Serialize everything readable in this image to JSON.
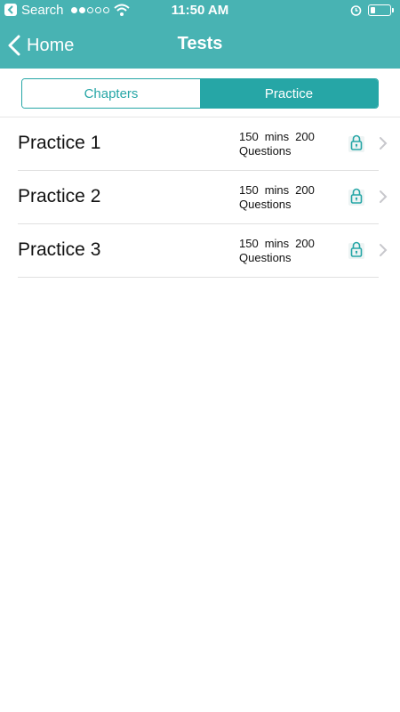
{
  "status_bar": {
    "back_app": "Search",
    "time": "11:50 AM",
    "signal_bars_on": 2,
    "signal_bars_total": 5,
    "battery_level": 0.25
  },
  "nav": {
    "back_label": "Home",
    "title": "Tests"
  },
  "tabs": [
    {
      "label": "Chapters",
      "selected": false
    },
    {
      "label": "Practice",
      "selected": true
    }
  ],
  "practices": [
    {
      "title": "Practice 1",
      "duration": "150",
      "duration_unit": "mins",
      "questions": "200",
      "questions_label": "Questions",
      "locked": true
    },
    {
      "title": "Practice 2",
      "duration": "150",
      "duration_unit": "mins",
      "questions": "200",
      "questions_label": "Questions",
      "locked": true
    },
    {
      "title": "Practice 3",
      "duration": "150",
      "duration_unit": "mins",
      "questions": "200",
      "questions_label": "Questions",
      "locked": true
    }
  ],
  "colors": {
    "header": "#48b3b3",
    "accent": "#26a6a6",
    "divider": "#e0e0e0",
    "chevron": "#c7c7cc"
  },
  "icons": {
    "status_back": "back-arrow-icon",
    "wifi": "wifi-icon",
    "alarm": "alarm-clock-icon",
    "battery": "battery-icon",
    "nav_back": "chevron-left-icon",
    "lock": "lock-icon",
    "row_chevron": "chevron-right-icon"
  }
}
